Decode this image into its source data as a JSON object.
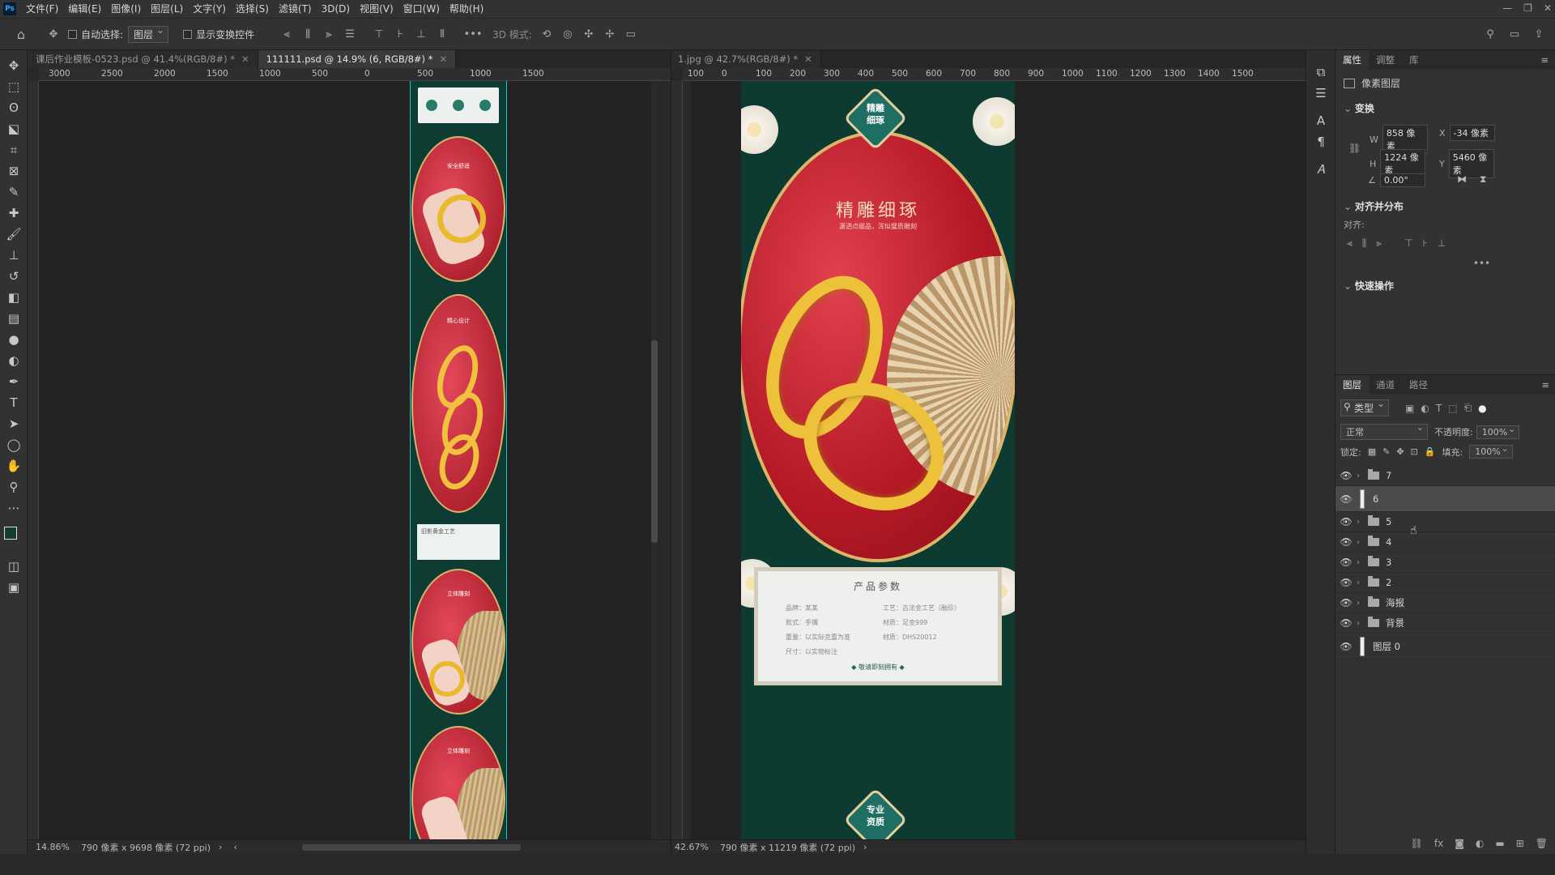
{
  "app": {
    "logo": "Ps"
  },
  "menu": [
    "文件(F)",
    "编辑(E)",
    "图像(I)",
    "图层(L)",
    "文字(Y)",
    "选择(S)",
    "滤镜(T)",
    "3D(D)",
    "视图(V)",
    "窗口(W)",
    "帮助(H)"
  ],
  "window_controls": [
    "—",
    "❐",
    "✕"
  ],
  "options": {
    "auto_select_label": "自动选择:",
    "auto_select_value": "图层",
    "show_transform_label": "显示变换控件",
    "mode_label": "3D 模式:"
  },
  "tools": [
    {
      "name": "move-tool",
      "glyph": "✥"
    },
    {
      "name": "marquee-tool",
      "glyph": "⬚"
    },
    {
      "name": "lasso-tool",
      "glyph": "ʘ"
    },
    {
      "name": "object-select-tool",
      "glyph": "⬕"
    },
    {
      "name": "crop-tool",
      "glyph": "⌗"
    },
    {
      "name": "frame-tool",
      "glyph": "⊠"
    },
    {
      "name": "eyedropper-tool",
      "glyph": "✎"
    },
    {
      "name": "healing-tool",
      "glyph": "✚"
    },
    {
      "name": "brush-tool",
      "glyph": "🖌"
    },
    {
      "name": "stamp-tool",
      "glyph": "⊥"
    },
    {
      "name": "history-brush-tool",
      "glyph": "↺"
    },
    {
      "name": "eraser-tool",
      "glyph": "◧"
    },
    {
      "name": "gradient-tool",
      "glyph": "▤"
    },
    {
      "name": "blur-tool",
      "glyph": "●"
    },
    {
      "name": "dodge-tool",
      "glyph": "◐"
    },
    {
      "name": "pen-tool",
      "glyph": "✒"
    },
    {
      "name": "type-tool",
      "glyph": "T"
    },
    {
      "name": "path-select-tool",
      "glyph": "➤"
    },
    {
      "name": "shape-tool",
      "glyph": "◯"
    },
    {
      "name": "hand-tool",
      "glyph": "✋"
    },
    {
      "name": "zoom-tool",
      "glyph": "⚲"
    },
    {
      "name": "more-tools",
      "glyph": "⋯"
    }
  ],
  "doc_left": {
    "tabs": [
      {
        "label": "课后作业模板-0523.psd @ 41.4%(RGB/8#) *",
        "active": false
      },
      {
        "label": "111111.psd @ 14.9% (6, RGB/8#) *",
        "active": true
      }
    ],
    "ruler": [
      "3000",
      "2500",
      "2000",
      "1500",
      "1000",
      "500",
      "0",
      "500",
      "1000",
      "1500"
    ],
    "zoom": "14.86%",
    "info": "790 像素 x 9698 像素 (72 ppi)",
    "sections": [
      {
        "title": "安全舒适",
        "sub": "SECURE AND COMFORTABLE"
      },
      {
        "title": "精心设计",
        "sub": "CAREFULLY DESIGNED"
      },
      {
        "title": "旧影黄金工艺",
        "sub": ""
      },
      {
        "title": "立体雕刻",
        "sub": ""
      },
      {
        "title": "立体雕刻",
        "sub": ""
      }
    ]
  },
  "doc_right": {
    "tab": {
      "label": "1.jpg @ 42.7%(RGB/8#) *",
      "active": false
    },
    "ruler": [
      "100",
      "0",
      "100",
      "200",
      "300",
      "400",
      "500",
      "600",
      "700",
      "800",
      "900",
      "1000",
      "1100",
      "1200",
      "1300",
      "1400",
      "1500"
    ],
    "zoom": "42.67%",
    "info": "790 像素 x 11219 像素 (72 ppi)",
    "badge_top": "精雕\n细琢",
    "headline": "精雕细琢",
    "subline": "潇洒点缀品，浑似璧质雕刻",
    "params_title": "产品参数",
    "params": [
      [
        "品牌：某某",
        "工艺：古法金工艺（融珍）"
      ],
      [
        "款式：手镯",
        "材质：足金999"
      ],
      [
        "重量：以实际克重为准",
        "材质：DHS20012"
      ],
      [
        "尺寸：以实物标注",
        ""
      ]
    ],
    "params_footer": "敬请即刻拥有",
    "badge_bottom": "专业\n资质"
  },
  "panels": {
    "top_tabs": [
      "属性",
      "调整",
      "库"
    ],
    "pixel_layer": "像素图层",
    "transform_title": "变换",
    "w_label": "W",
    "w": "858 像素",
    "x_label": "X",
    "x": "-34 像素",
    "h_label": "H",
    "h": "1224 像素",
    "y_label": "Y",
    "y": "5460 像素",
    "angle": "0.00°",
    "align_title": "对齐并分布",
    "align_label": "对齐:",
    "quick_title": "快速操作",
    "layer_tabs": [
      "图层",
      "通道",
      "路径"
    ],
    "filter": "类型",
    "blend": "正常",
    "opacity_label": "不透明度:",
    "opacity": "100%",
    "lock_label": "锁定:",
    "fill_label": "填充:",
    "fill": "100%",
    "layers": [
      {
        "name": "7",
        "type": "group",
        "selected": false
      },
      {
        "name": "6",
        "type": "layer",
        "selected": true
      },
      {
        "name": "5",
        "type": "group",
        "selected": false
      },
      {
        "name": "4",
        "type": "group",
        "selected": false
      },
      {
        "name": "3",
        "type": "group",
        "selected": false
      },
      {
        "name": "2",
        "type": "group",
        "selected": false
      },
      {
        "name": "海报",
        "type": "group",
        "selected": false
      },
      {
        "name": "背景",
        "type": "group",
        "selected": false
      },
      {
        "name": "图层 0",
        "type": "layer",
        "selected": false
      }
    ]
  },
  "colors": {
    "accent_red": "#c8242c",
    "green": "#0f3e34",
    "gold": "#e2b43a"
  }
}
